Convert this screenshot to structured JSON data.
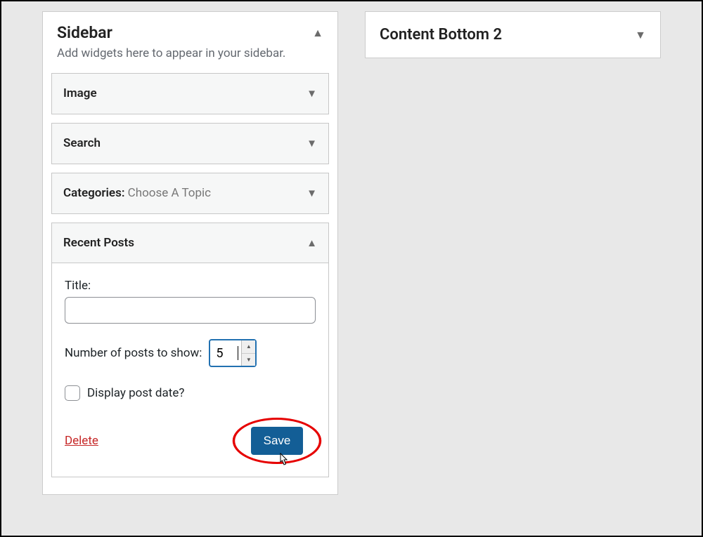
{
  "sidebar_area": {
    "title": "Sidebar",
    "description": "Add widgets here to appear in your sidebar.",
    "widgets": {
      "image": {
        "title": "Image"
      },
      "search": {
        "title": "Search"
      },
      "categories": {
        "title_prefix": "Categories:",
        "title_suffix": " Choose A Topic"
      },
      "recent_posts": {
        "title": "Recent Posts",
        "fields": {
          "title_label": "Title:",
          "title_value": "",
          "num_label": "Number of posts to show:",
          "num_value": "5",
          "display_date_label": "Display post date?"
        },
        "actions": {
          "delete": "Delete",
          "save": "Save"
        }
      }
    }
  },
  "content_bottom_area": {
    "title": "Content Bottom 2"
  }
}
